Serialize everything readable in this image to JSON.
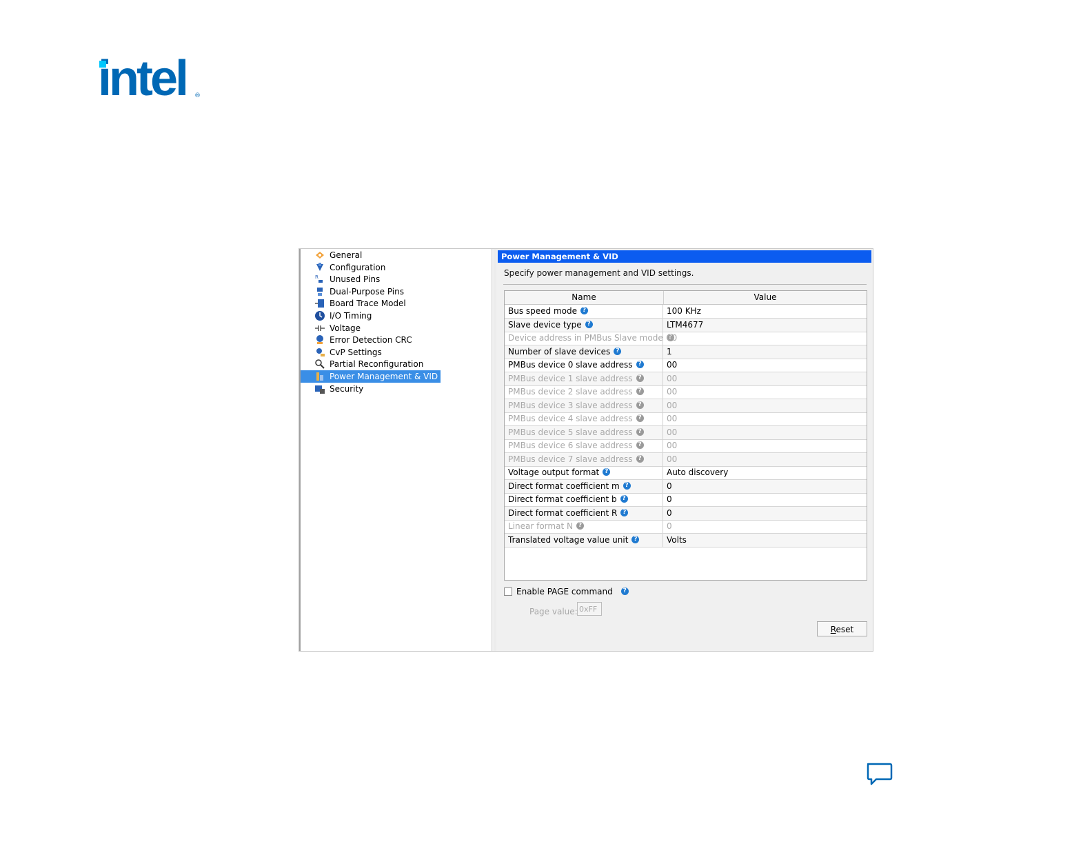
{
  "logo": {
    "text": "intel",
    "registered": "®"
  },
  "tree": {
    "items": [
      {
        "label": "General",
        "icon": "general-icon"
      },
      {
        "label": "Configuration",
        "icon": "configuration-icon"
      },
      {
        "label": "Unused Pins",
        "icon": "unused-pins-icon"
      },
      {
        "label": "Dual-Purpose Pins",
        "icon": "dual-purpose-pins-icon"
      },
      {
        "label": "Board Trace Model",
        "icon": "board-trace-model-icon"
      },
      {
        "label": "I/O Timing",
        "icon": "io-timing-icon"
      },
      {
        "label": "Voltage",
        "icon": "voltage-icon"
      },
      {
        "label": "Error Detection CRC",
        "icon": "error-detection-crc-icon"
      },
      {
        "label": "CvP Settings",
        "icon": "cvp-settings-icon"
      },
      {
        "label": "Partial Reconfiguration",
        "icon": "partial-reconfiguration-icon"
      },
      {
        "label": "Power Management & VID",
        "icon": "power-management-icon",
        "selected": true
      },
      {
        "label": "Security",
        "icon": "security-icon"
      }
    ]
  },
  "panel": {
    "title": "Power Management & VID",
    "description": "Specify power management and VID settings.",
    "columns": {
      "name": "Name",
      "value": "Value"
    },
    "rows": [
      {
        "name": "Bus speed mode",
        "value": "100 KHz",
        "enabled": true
      },
      {
        "name": "Slave device type",
        "value": "LTM4677",
        "enabled": true
      },
      {
        "name": "Device address in PMBus Slave mode",
        "value": "00",
        "enabled": false
      },
      {
        "name": "Number of slave devices",
        "value": "1",
        "enabled": true
      },
      {
        "name": "PMBus device 0 slave address",
        "value": "00",
        "enabled": true
      },
      {
        "name": "PMBus device 1 slave address",
        "value": "00",
        "enabled": false
      },
      {
        "name": "PMBus device 2 slave address",
        "value": "00",
        "enabled": false
      },
      {
        "name": "PMBus device 3 slave address",
        "value": "00",
        "enabled": false
      },
      {
        "name": "PMBus device 4 slave address",
        "value": "00",
        "enabled": false
      },
      {
        "name": "PMBus device 5 slave address",
        "value": "00",
        "enabled": false
      },
      {
        "name": "PMBus device 6 slave address",
        "value": "00",
        "enabled": false
      },
      {
        "name": "PMBus device 7 slave address",
        "value": "00",
        "enabled": false
      },
      {
        "name": "Voltage output format",
        "value": "Auto discovery",
        "enabled": true
      },
      {
        "name": "Direct format coefficient m",
        "value": "0",
        "enabled": true
      },
      {
        "name": "Direct format coefficient b",
        "value": "0",
        "enabled": true
      },
      {
        "name": "Direct format coefficient R",
        "value": "0",
        "enabled": true
      },
      {
        "name": "Linear format N",
        "value": "0",
        "enabled": false
      },
      {
        "name": "Translated voltage value unit",
        "value": "Volts",
        "enabled": true
      }
    ],
    "enable_page": {
      "label": "Enable PAGE command",
      "checked": false
    },
    "page_value": {
      "label": "Page value:",
      "value": "0xFF"
    },
    "reset": {
      "label_u": "R",
      "label_rest": "eset"
    }
  },
  "colors": {
    "header": "#0b5cf0",
    "selected": "#3a8ee6",
    "help": "#1f7ad1",
    "brand": "#0068b5"
  }
}
